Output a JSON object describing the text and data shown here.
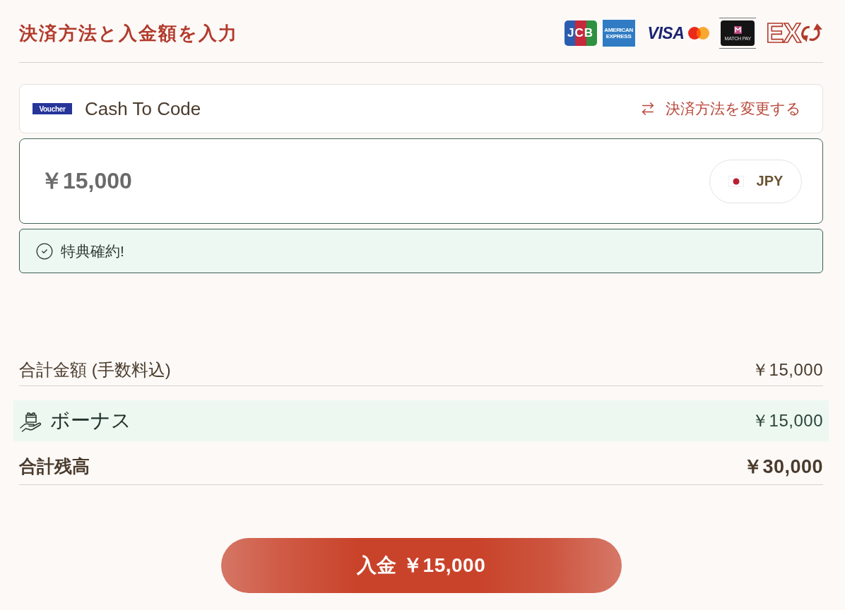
{
  "header": {
    "title": "決済方法と入金額を入力",
    "payment_logos": [
      {
        "kind": "jcb",
        "text": "JCB"
      },
      {
        "kind": "amex",
        "text": "AMERICAN EXPRESS"
      },
      {
        "kind": "visa",
        "text": "VISA"
      },
      {
        "kind": "mastercard"
      },
      {
        "kind": "matchpay",
        "text": "MATCH PAY"
      },
      {
        "kind": "ex",
        "text": "EX"
      }
    ]
  },
  "payment_method": {
    "logo_text": "Voucher",
    "name": "Cash To Code",
    "change_link": "決済方法を変更する"
  },
  "amount": {
    "value": "￥15,000",
    "currency": "JPY"
  },
  "bonus_notice": {
    "text": "特典確約!"
  },
  "summary": [
    {
      "kind": "subtotal",
      "label": "合計金額 (手数料込)",
      "value": "￥15,000"
    },
    {
      "kind": "bonus",
      "label": "ボーナス",
      "value": "￥15,000"
    },
    {
      "kind": "total",
      "label": "合計残高",
      "value": "￥30,000"
    }
  ],
  "deposit_button": {
    "label": "入金 ￥15,000"
  }
}
